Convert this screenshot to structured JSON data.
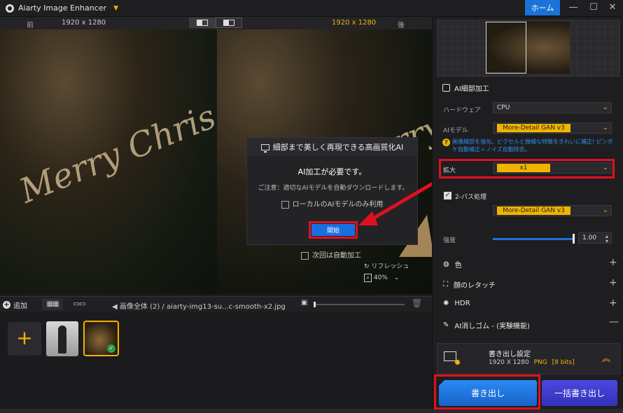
{
  "app": {
    "title": "Aiarty Image Enhancer",
    "home_label": "ホーム"
  },
  "window_controls": {
    "minimize": "—",
    "maximize": "☐",
    "close": "✕"
  },
  "compare": {
    "before_label": "前",
    "before_size": "1920 x 1280",
    "after_size": "1920 x 1280",
    "after_label": "後"
  },
  "image_text": {
    "left": "Merry Chris",
    "right": "Merry Chris"
  },
  "dialog": {
    "title": "細部まで美しく再現できる高画質化AI",
    "message": "AI加工が必要です。",
    "note": "ご注意：適切なAIモデルを自動ダウンロードします。",
    "local_only": "ローカルのAIモデルのみ利用",
    "start": "開始"
  },
  "auto_process": "次回は自動加工",
  "refresh": "リフレッシュ",
  "zoom": "40%",
  "strip": {
    "add": "追加",
    "breadcrumb_all": "画像全体 (2)",
    "breadcrumb_sep": "/",
    "filename": "aiarty-img13-su...c-smooth-x2.jpg"
  },
  "panel": {
    "section_title": "AI細部加工",
    "hardware_label": "ハードウェア",
    "hardware_value": "CPU",
    "model_label": "AIモデル",
    "model_value": "More-Detail GAN  v3",
    "model_info": "画像細部を強化。ピクセルと微細な特徴をきれいに補正! ピンボケ自動補正＋ノイズ自動除去。",
    "scale_label": "拡大",
    "scale_value": "x1",
    "twopass_label": "2-パス処理",
    "twopass_model": "More-Detail GAN  v3",
    "strength_label": "強度",
    "strength_value": "1.00",
    "strength_fraction": 1.0,
    "features": [
      "色",
      "顔のレタッチ",
      "HDR",
      "AI消しゴム - (実験機能)"
    ],
    "export_title": "書き出し設定",
    "export_size": "1920 X 1280",
    "export_format": "PNG",
    "export_bits": "[8 bits]",
    "export_button": "書き出し",
    "batch_button": "一括書き出し"
  },
  "colors": {
    "accent_yellow": "#f0b400",
    "accent_blue": "#1a73d9",
    "highlight_red": "#e01020"
  }
}
